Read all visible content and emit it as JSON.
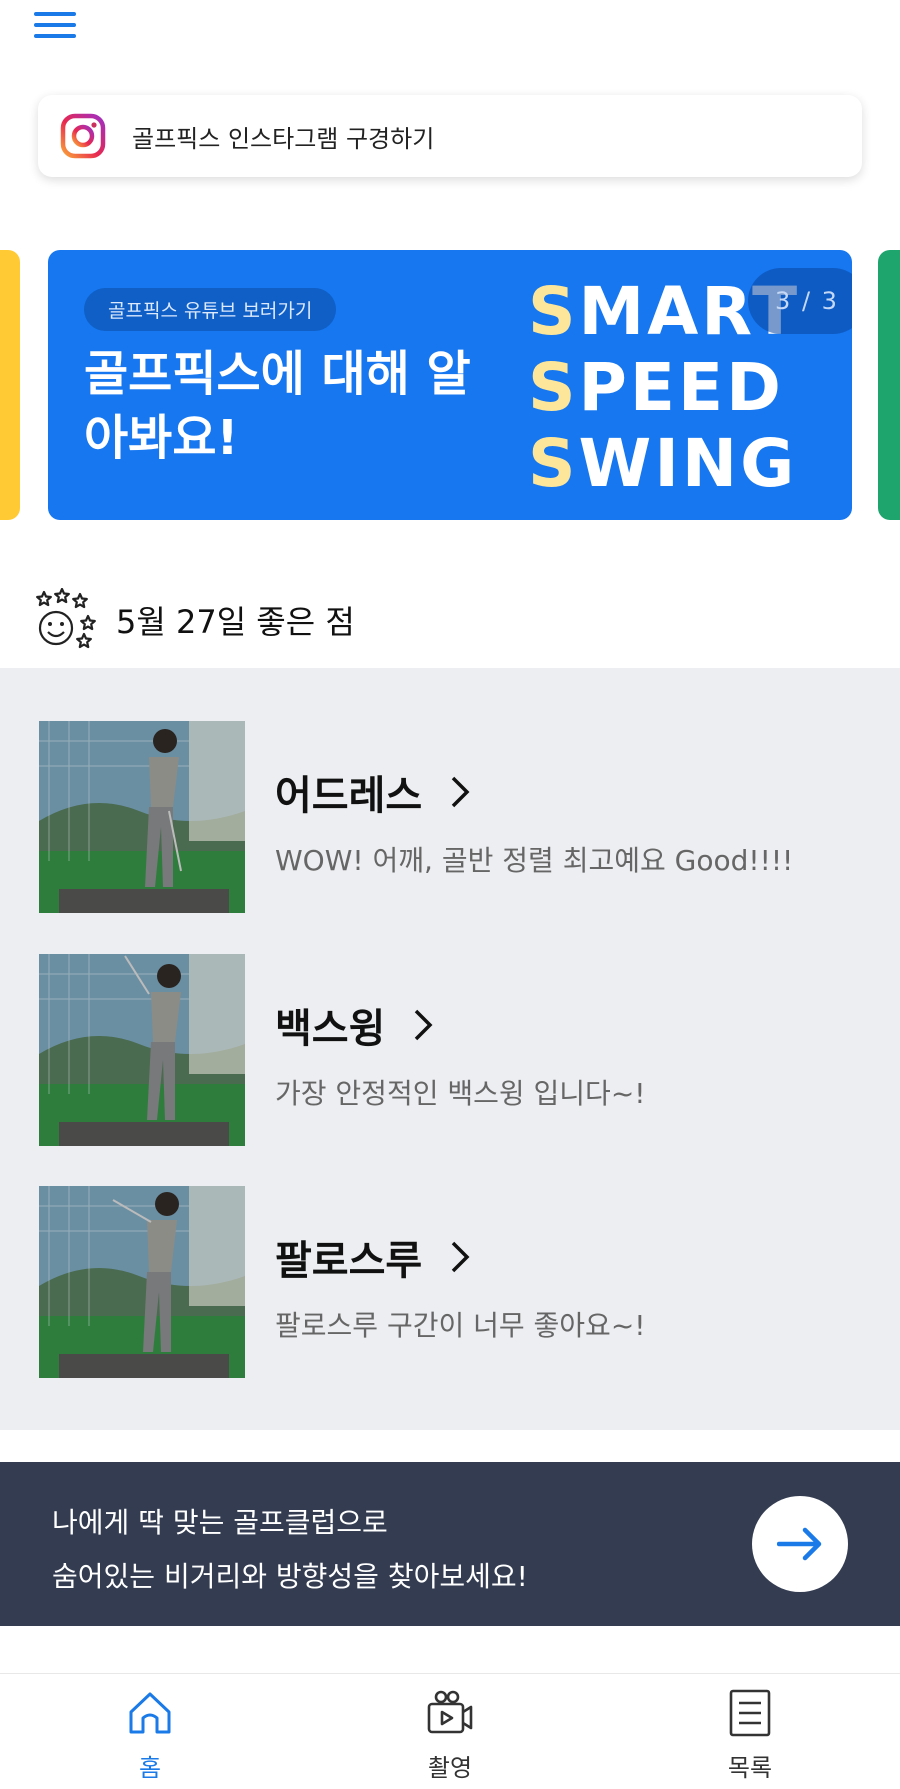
{
  "header": {
    "menu_icon": "hamburger-menu-icon"
  },
  "instagram": {
    "icon": "instagram-icon",
    "label": "골프픽스 인스타그램 구경하기"
  },
  "banner": {
    "pill": "골프픽스 유튜브 보러가기",
    "title": "골프픽스에 대해 알아봐요!",
    "tagline": [
      {
        "first": "S",
        "rest": "MART"
      },
      {
        "first": "S",
        "rest": "PEED"
      },
      {
        "first": "S",
        "rest": "WING"
      }
    ],
    "counter": "3 / 3",
    "accent": "#1677f0"
  },
  "good_points": {
    "icon": "smiley-stars-icon",
    "title": "5월 27일 좋은 점",
    "items": [
      {
        "title": "어드레스",
        "desc": "WOW! 어깨, 골반 정렬 최고예요 Good!!!!",
        "thumb": "golfer-address-photo"
      },
      {
        "title": "백스윙",
        "desc": "가장 안정적인 백스윙 입니다~!",
        "thumb": "golfer-backswing-photo"
      },
      {
        "title": "팔로스루",
        "desc": "팔로스루 구간이 너무 좋아요~!",
        "thumb": "golfer-followthrough-photo"
      }
    ]
  },
  "club_banner": {
    "line1": "나에게 딱 맞는 골프클럽으로",
    "line2": "숨어있는 비거리와 방향성을 찾아보세요!",
    "button_icon": "arrow-right-icon",
    "background": "#333c51"
  },
  "nav": {
    "items": [
      {
        "label": "홈",
        "icon": "home-icon",
        "active": true
      },
      {
        "label": "촬영",
        "icon": "video-camera-icon",
        "active": false
      },
      {
        "label": "목록",
        "icon": "list-document-icon",
        "active": false
      }
    ],
    "active_color": "#1a7ae8"
  }
}
